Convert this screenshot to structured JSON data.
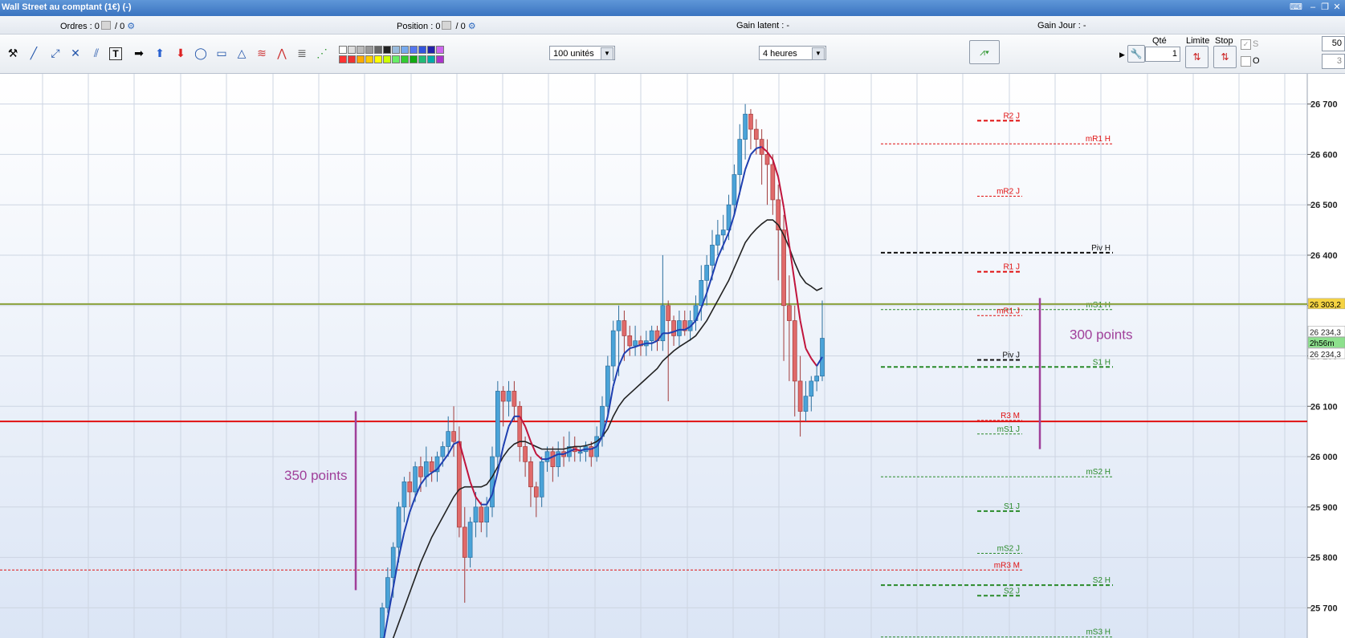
{
  "window": {
    "title": "Wall Street au comptant (1€) (-)"
  },
  "infobar": {
    "ordres_label": "Ordres : ",
    "ordres_v1": "0",
    "ordres_v2": "/ 0",
    "position_label": "Position : ",
    "position_v1": "0",
    "position_v2": "/ 0",
    "gain_latent": "Gain latent : -",
    "gain_jour": "Gain Jour : -"
  },
  "toolbar": {
    "units_select": "100 unités",
    "period_select": "4 heures",
    "qte_label": "Qté",
    "qte_value": "1",
    "limite_label": "Limite",
    "stop_label": "Stop",
    "s_label": "S",
    "s_value": "50",
    "o_label": "O",
    "o_value": "3"
  },
  "colors": {
    "bull": "#4aa3d8",
    "bear": "#e06a6a",
    "ma_fast_up": "#1f3fb0",
    "ma_fast_down": "#c0143c",
    "ma_slow": "#222222",
    "horizontal_red": "#e01010",
    "horizontal_olive": "#8aa03a",
    "annotation": "#a0409a",
    "pivot_red": "#e01010",
    "pivot_green": "#2a8a2a"
  },
  "chart_data": {
    "type": "candlestick",
    "ylim": [
      25640,
      26760
    ],
    "y_ticks": [
      "26 700",
      "26 600",
      "26 500",
      "26 400",
      "26 300",
      "26 200",
      "26 100",
      "26 000",
      "25 900",
      "25 800",
      "25 700"
    ],
    "y_tick_values": [
      26700,
      26600,
      26500,
      26400,
      26300,
      26200,
      26100,
      26000,
      25900,
      25800,
      25700
    ],
    "price_tags": [
      {
        "label": "26 303,2",
        "value": 26303,
        "style": "yellow"
      },
      {
        "label": "26 234,3",
        "value": 26248,
        "style": "white"
      },
      {
        "label": "2h56m",
        "value": 26226,
        "style": "green"
      },
      {
        "label": "26 234,3",
        "value": 26204,
        "style": "white"
      }
    ],
    "horizontal_lines": [
      {
        "value": 26303,
        "color": "olive"
      },
      {
        "value": 26070,
        "color": "red"
      }
    ],
    "levels": [
      {
        "label": "R2 J",
        "value": 26667,
        "color": "red",
        "dash": "bold",
        "span": "short"
      },
      {
        "label": "mR1 H",
        "value": 26621,
        "color": "red",
        "dash": "thin",
        "span": "long"
      },
      {
        "label": "mR2 J",
        "value": 26517,
        "color": "red",
        "dash": "thin",
        "span": "short"
      },
      {
        "label": "Piv H",
        "value": 26405,
        "color": "black",
        "dash": "bold",
        "span": "long"
      },
      {
        "label": "R1 J",
        "value": 26367,
        "color": "red",
        "dash": "bold",
        "span": "short"
      },
      {
        "label": "mS1 H",
        "value": 26292,
        "color": "green",
        "dash": "thin",
        "span": "long"
      },
      {
        "label": "mR1 J",
        "value": 26280,
        "color": "red",
        "dash": "thin",
        "span": "short"
      },
      {
        "label": "Piv J",
        "value": 26192,
        "color": "black",
        "dash": "bold",
        "span": "short"
      },
      {
        "label": "S1 H",
        "value": 26178,
        "color": "green",
        "dash": "bold",
        "span": "long"
      },
      {
        "label": "R3 M",
        "value": 26072,
        "color": "red",
        "dash": "thin",
        "span": "short"
      },
      {
        "label": "mS1 J",
        "value": 26045,
        "color": "green",
        "dash": "thin",
        "span": "short"
      },
      {
        "label": "mS2 H",
        "value": 25960,
        "color": "green",
        "dash": "thin",
        "span": "long"
      },
      {
        "label": "S1 J",
        "value": 25892,
        "color": "green",
        "dash": "bold",
        "span": "short"
      },
      {
        "label": "mS2 J",
        "value": 25808,
        "color": "green",
        "dash": "thin",
        "span": "short"
      },
      {
        "label": "mR3 M",
        "value": 25775,
        "color": "red",
        "dash": "thin",
        "span": "full"
      },
      {
        "label": "S2 H",
        "value": 25745,
        "color": "green",
        "dash": "bold",
        "span": "long"
      },
      {
        "label": "S2 J",
        "value": 25724,
        "color": "green",
        "dash": "bold",
        "span": "short"
      },
      {
        "label": "mS3 H",
        "value": 25642,
        "color": "green",
        "dash": "thin",
        "span": "long"
      }
    ],
    "annotations": [
      {
        "text": "350 points"
      },
      {
        "text": "300 points"
      }
    ],
    "candles": [
      [
        25640,
        25700,
        25620,
        25710
      ],
      [
        25700,
        25760,
        25690,
        25780
      ],
      [
        25760,
        25820,
        25720,
        25830
      ],
      [
        25820,
        25900,
        25790,
        25910
      ],
      [
        25900,
        25950,
        25870,
        25960
      ],
      [
        25950,
        25930,
        25900,
        25970
      ],
      [
        25930,
        25980,
        25910,
        25990
      ],
      [
        25980,
        25960,
        25930,
        26000
      ],
      [
        25960,
        25990,
        25940,
        26020
      ],
      [
        25990,
        25970,
        25950,
        26000
      ],
      [
        25970,
        26000,
        25950,
        26010
      ],
      [
        26000,
        26020,
        25980,
        26030
      ],
      [
        26020,
        26050,
        26000,
        26080
      ],
      [
        26050,
        26030,
        26000,
        26100
      ],
      [
        26030,
        25860,
        25840,
        26060
      ],
      [
        25860,
        25800,
        25710,
        25900
      ],
      [
        25800,
        25870,
        25780,
        25880
      ],
      [
        25870,
        25900,
        25840,
        25930
      ],
      [
        25900,
        25870,
        25850,
        25910
      ],
      [
        25870,
        25900,
        25840,
        25920
      ],
      [
        25900,
        26000,
        25880,
        26020
      ],
      [
        26000,
        26130,
        25980,
        26150
      ],
      [
        26130,
        26110,
        26060,
        26140
      ],
      [
        26110,
        26130,
        26080,
        26150
      ],
      [
        26130,
        26100,
        26070,
        26150
      ],
      [
        26100,
        26020,
        25990,
        26110
      ],
      [
        26020,
        25990,
        25960,
        26040
      ],
      [
        25990,
        25940,
        25900,
        26000
      ],
      [
        25940,
        25920,
        25880,
        25950
      ],
      [
        25920,
        25990,
        25900,
        26000
      ],
      [
        25990,
        26010,
        25970,
        26020
      ],
      [
        26010,
        25980,
        25950,
        26020
      ],
      [
        25980,
        26010,
        25960,
        26030
      ],
      [
        26010,
        26000,
        25980,
        26040
      ],
      [
        26000,
        26020,
        25990,
        26050
      ],
      [
        26020,
        26010,
        25990,
        26040
      ],
      [
        26010,
        26010,
        25990,
        26020
      ],
      [
        26010,
        26020,
        25990,
        26030
      ],
      [
        26020,
        26000,
        25980,
        26030
      ],
      [
        26000,
        26040,
        25990,
        26060
      ],
      [
        26040,
        26100,
        26020,
        26120
      ],
      [
        26100,
        26180,
        26080,
        26200
      ],
      [
        26180,
        26250,
        26150,
        26270
      ],
      [
        26250,
        26270,
        26160,
        26300
      ],
      [
        26270,
        26240,
        26190,
        26290
      ],
      [
        26240,
        26220,
        26200,
        26260
      ],
      [
        26220,
        26230,
        26200,
        26260
      ],
      [
        26230,
        26220,
        26200,
        26240
      ],
      [
        26220,
        26230,
        26200,
        26250
      ],
      [
        26230,
        26250,
        26210,
        26260
      ],
      [
        26250,
        26230,
        26210,
        26260
      ],
      [
        26230,
        26300,
        26210,
        26400
      ],
      [
        26300,
        26270,
        26110,
        26310
      ],
      [
        26270,
        26240,
        26220,
        26280
      ],
      [
        26240,
        26270,
        26220,
        26290
      ],
      [
        26270,
        26250,
        26240,
        26290
      ],
      [
        26250,
        26270,
        26230,
        26290
      ],
      [
        26270,
        26300,
        26250,
        26320
      ],
      [
        26300,
        26350,
        26270,
        26380
      ],
      [
        26350,
        26380,
        26300,
        26400
      ],
      [
        26380,
        26420,
        26350,
        26450
      ],
      [
        26420,
        26440,
        26400,
        26470
      ],
      [
        26440,
        26450,
        26410,
        26480
      ],
      [
        26450,
        26500,
        26430,
        26520
      ],
      [
        26500,
        26560,
        26480,
        26580
      ],
      [
        26560,
        26630,
        26520,
        26660
      ],
      [
        26630,
        26680,
        26590,
        26700
      ],
      [
        26680,
        26650,
        26610,
        26690
      ],
      [
        26650,
        26630,
        26600,
        26670
      ],
      [
        26630,
        26600,
        26540,
        26650
      ],
      [
        26600,
        26580,
        26500,
        26630
      ],
      [
        26580,
        26510,
        26480,
        26600
      ],
      [
        26510,
        26450,
        26350,
        26540
      ],
      [
        26450,
        26300,
        26190,
        26480
      ],
      [
        26300,
        26270,
        26150,
        26360
      ],
      [
        26270,
        26150,
        26080,
        26300
      ],
      [
        26150,
        26090,
        26040,
        26200
      ],
      [
        26090,
        26120,
        26070,
        26150
      ],
      [
        26120,
        26150,
        26090,
        26160
      ],
      [
        26150,
        26160,
        26130,
        26180
      ],
      [
        26160,
        26235,
        26150,
        26310
      ]
    ],
    "ma_fast": [
      25620,
      25680,
      25740,
      25800,
      25850,
      25890,
      25920,
      25945,
      25960,
      25968,
      25975,
      25990,
      26005,
      26025,
      26030,
      25990,
      25950,
      25920,
      25905,
      25905,
      25925,
      25970,
      26020,
      26060,
      26080,
      26080,
      26060,
      26030,
      26005,
      25995,
      25995,
      26000,
      26005,
      26005,
      26010,
      26015,
      26012,
      26015,
      26015,
      26020,
      26040,
      26080,
      26140,
      26180,
      26205,
      26215,
      26218,
      26222,
      26225,
      26225,
      26230,
      26245,
      26245,
      26248,
      26252,
      26252,
      26258,
      26270,
      26295,
      26325,
      26360,
      26395,
      26420,
      26445,
      26480,
      26525,
      26570,
      26600,
      26612,
      26615,
      26605,
      26590,
      26555,
      26495,
      26420,
      26345,
      26270,
      26215,
      26195,
      26180,
      26198
    ],
    "ma_slow": [
      25580,
      25610,
      25640,
      25670,
      25700,
      25730,
      25760,
      25790,
      25815,
      25840,
      25860,
      25880,
      25900,
      25920,
      25935,
      25940,
      25940,
      25940,
      25940,
      25945,
      25960,
      25980,
      26000,
      26015,
      26025,
      26030,
      26030,
      26025,
      26020,
      26015,
      26015,
      26015,
      26015,
      26015,
      26018,
      26020,
      26020,
      26022,
      26025,
      26030,
      26040,
      26055,
      26080,
      26100,
      26115,
      26125,
      26135,
      26145,
      26155,
      26165,
      26175,
      26190,
      26200,
      26210,
      26218,
      26225,
      26232,
      26240,
      26255,
      26270,
      26290,
      26310,
      26330,
      26350,
      26375,
      26400,
      26425,
      26440,
      26452,
      26462,
      26470,
      26470,
      26460,
      26440,
      26415,
      26385,
      26360,
      26345,
      26338,
      26330,
      26335
    ]
  }
}
